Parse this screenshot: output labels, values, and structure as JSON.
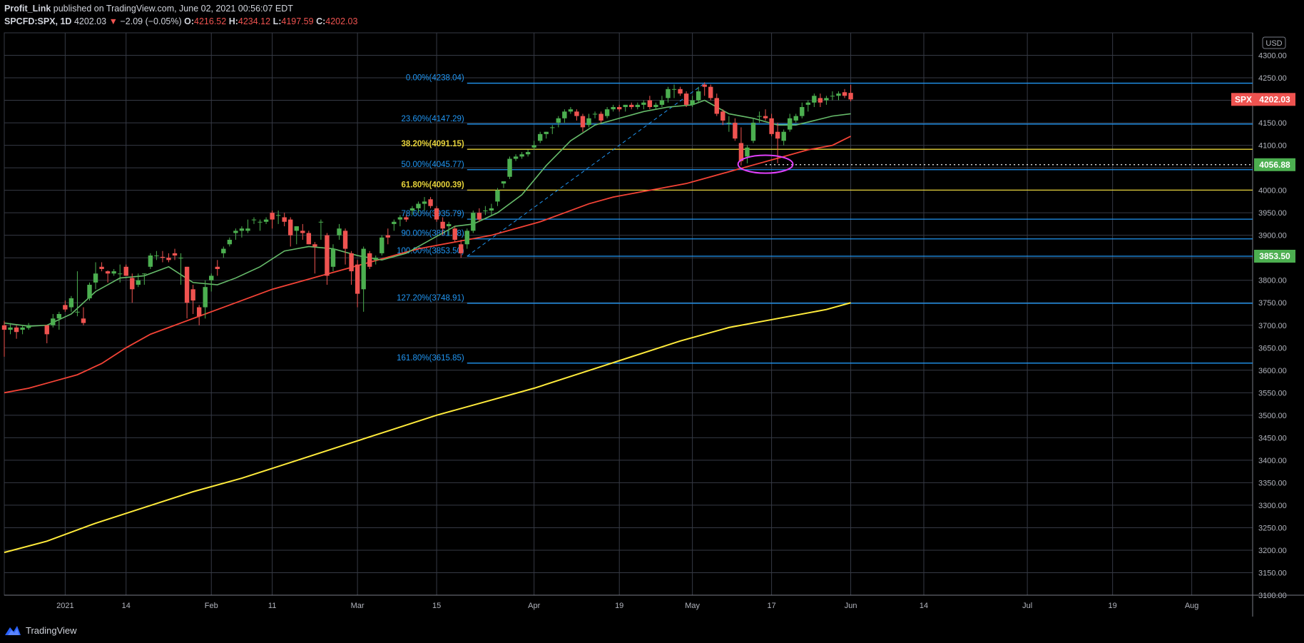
{
  "header": {
    "author": "Profit_Link",
    "published": "published on TradingView.com, June 02, 2021 00:56:07 EDT",
    "symbol": "SPCFD:SPX, 1D",
    "last": "4202.03",
    "change_arrow": "▼",
    "change": "−2.09 (−0.05%)",
    "o_label": "O:",
    "o_value": "4216.52",
    "h_label": "H:",
    "h_value": "4234.12",
    "l_label": "L:",
    "l_value": "4197.59",
    "c_label": "C:",
    "c_value": "4202.03"
  },
  "footer": {
    "brand": "TradingView"
  },
  "colors": {
    "background": "#000000",
    "grid": "#363a45",
    "up": "#4caf50",
    "down": "#ef5350",
    "ema_short": "#66bb6a",
    "ema_long": "#f44336",
    "ma_yellow": "#ffeb3b",
    "fib_blue": "#2196f3",
    "fib_yellow": "#e6d23a",
    "ellipse": "#e040fb"
  },
  "chart_data": {
    "type": "candlestick",
    "ylim": [
      3100,
      4350
    ],
    "currency": "USD",
    "y_ticks": [
      3100,
      3150,
      3200,
      3250,
      3300,
      3350,
      3400,
      3450,
      3500,
      3550,
      3600,
      3650,
      3700,
      3750,
      3800,
      3850,
      3900,
      3950,
      4000,
      4050,
      4100,
      4150,
      4200,
      4250,
      4300
    ],
    "x_ticks": [
      "2021",
      "14",
      "Feb",
      "11",
      "Mar",
      "15",
      "Apr",
      "19",
      "May",
      "17",
      "Jun",
      "14",
      "Jul",
      "19",
      "Aug"
    ],
    "x_tick_days": [
      3,
      13,
      27,
      37,
      51,
      64,
      80,
      94,
      106,
      119,
      132,
      144,
      161,
      175,
      188
    ],
    "x_range_days": [
      -7,
      198
    ],
    "candles": [
      [
        -7,
        3700,
        3710,
        3630,
        3690
      ],
      [
        -6,
        3690,
        3705,
        3680,
        3695
      ],
      [
        -5,
        3695,
        3700,
        3670,
        3685
      ],
      [
        -4,
        3690,
        3700,
        3680,
        3695
      ],
      [
        -3,
        3694,
        3705,
        3690,
        3700
      ],
      [
        0,
        3700,
        3700,
        3660,
        3680
      ],
      [
        1,
        3700,
        3725,
        3695,
        3715
      ],
      [
        2,
        3715,
        3730,
        3690,
        3725
      ],
      [
        3,
        3745,
        3755,
        3730,
        3735
      ],
      [
        4,
        3740,
        3765,
        3730,
        3760
      ],
      [
        5,
        3730,
        3820,
        3720,
        3730
      ],
      [
        6,
        3715,
        3740,
        3700,
        3705
      ],
      [
        7,
        3760,
        3795,
        3755,
        3790
      ],
      [
        8,
        3795,
        3840,
        3780,
        3815
      ],
      [
        9,
        3830,
        3840,
        3820,
        3825
      ],
      [
        10,
        3820,
        3822,
        3795,
        3815
      ],
      [
        11,
        3815,
        3825,
        3810,
        3820
      ],
      [
        12,
        3815,
        3835,
        3795,
        3815
      ],
      [
        13,
        3830,
        3835,
        3810,
        3810
      ],
      [
        14,
        3805,
        3815,
        3750,
        3780
      ],
      [
        15,
        3790,
        3815,
        3785,
        3800
      ],
      [
        16,
        3815,
        3815,
        3790,
        3815
      ],
      [
        17,
        3830,
        3860,
        3825,
        3855
      ],
      [
        18,
        3855,
        3865,
        3845,
        3855
      ],
      [
        19,
        3852,
        3865,
        3840,
        3850
      ],
      [
        20,
        3850,
        3860,
        3840,
        3845
      ],
      [
        21,
        3860,
        3870,
        3845,
        3855
      ],
      [
        22,
        3850,
        3860,
        3790,
        3850
      ],
      [
        23,
        3830,
        3830,
        3715,
        3750
      ],
      [
        24,
        3780,
        3790,
        3725,
        3755
      ],
      [
        25,
        3740,
        3745,
        3700,
        3720
      ],
      [
        26,
        3740,
        3800,
        3715,
        3785
      ],
      [
        27,
        3800,
        3815,
        3775,
        3810
      ],
      [
        28,
        3830,
        3845,
        3810,
        3825
      ],
      [
        29,
        3860,
        3875,
        3850,
        3870
      ],
      [
        30,
        3880,
        3895,
        3875,
        3890
      ],
      [
        31,
        3905,
        3915,
        3890,
        3910
      ],
      [
        32,
        3910,
        3920,
        3895,
        3915
      ],
      [
        33,
        3910,
        3935,
        3905,
        3915
      ],
      [
        34,
        3935,
        3940,
        3925,
        3935
      ],
      [
        35,
        3930,
        3935,
        3910,
        3930
      ],
      [
        36,
        3930,
        3940,
        3925,
        3935
      ],
      [
        37,
        3950,
        3955,
        3915,
        3935
      ],
      [
        38,
        3945,
        3955,
        3925,
        3945
      ],
      [
        39,
        3940,
        3950,
        3920,
        3930
      ],
      [
        40,
        3935,
        3940,
        3875,
        3900
      ],
      [
        41,
        3910,
        3920,
        3880,
        3920
      ],
      [
        42,
        3910,
        3925,
        3890,
        3905
      ],
      [
        43,
        3905,
        3910,
        3880,
        3880
      ],
      [
        44,
        3880,
        3885,
        3815,
        3875
      ],
      [
        45,
        3930,
        3935,
        3890,
        3930
      ],
      [
        46,
        3900,
        3905,
        3790,
        3810
      ],
      [
        47,
        3830,
        3880,
        3820,
        3870
      ],
      [
        48,
        3900,
        3925,
        3890,
        3915
      ],
      [
        49,
        3910,
        3915,
        3835,
        3870
      ],
      [
        50,
        3860,
        3865,
        3790,
        3820
      ],
      [
        51,
        3835,
        3845,
        3740,
        3770
      ],
      [
        52,
        3780,
        3875,
        3730,
        3870
      ],
      [
        53,
        3860,
        3865,
        3825,
        3830
      ],
      [
        54,
        3845,
        3855,
        3835,
        3850
      ],
      [
        55,
        3860,
        3900,
        3855,
        3895
      ],
      [
        56,
        3900,
        3915,
        3880,
        3895
      ],
      [
        57,
        3925,
        3935,
        3910,
        3930
      ],
      [
        58,
        3935,
        3945,
        3920,
        3940
      ],
      [
        59,
        3940,
        3945,
        3930,
        3935
      ],
      [
        60,
        3955,
        3965,
        3945,
        3960
      ],
      [
        61,
        3960,
        3975,
        3950,
        3970
      ],
      [
        62,
        3970,
        3985,
        3955,
        3975
      ],
      [
        63,
        3980,
        3985,
        3960,
        3965
      ],
      [
        64,
        3960,
        3965,
        3930,
        3935
      ],
      [
        65,
        3930,
        3940,
        3900,
        3915
      ],
      [
        66,
        3920,
        3930,
        3900,
        3925
      ],
      [
        67,
        3915,
        3920,
        3885,
        3890
      ],
      [
        68,
        3880,
        3890,
        3850,
        3860
      ],
      [
        69,
        3880,
        3915,
        3870,
        3910
      ],
      [
        70,
        3910,
        3955,
        3905,
        3950
      ],
      [
        71,
        3950,
        3960,
        3930,
        3935
      ],
      [
        72,
        3955,
        3965,
        3945,
        3955
      ],
      [
        73,
        3955,
        3970,
        3945,
        3960
      ],
      [
        74,
        3975,
        4005,
        3965,
        4000
      ],
      [
        75,
        4015,
        4020,
        4005,
        4020
      ],
      [
        76,
        4030,
        4075,
        4025,
        4070
      ],
      [
        77,
        4070,
        4080,
        4065,
        4075
      ],
      [
        78,
        4075,
        4085,
        4070,
        4080
      ],
      [
        79,
        4080,
        4090,
        4075,
        4085
      ],
      [
        80,
        4095,
        4110,
        4090,
        4100
      ],
      [
        81,
        4110,
        4130,
        4105,
        4125
      ],
      [
        82,
        4125,
        4130,
        4115,
        4130
      ],
      [
        83,
        4140,
        4145,
        4125,
        4140
      ],
      [
        84,
        4150,
        4165,
        4140,
        4160
      ],
      [
        85,
        4160,
        4180,
        4150,
        4175
      ],
      [
        86,
        4175,
        4185,
        4170,
        4180
      ],
      [
        87,
        4175,
        4180,
        4155,
        4165
      ],
      [
        88,
        4165,
        4170,
        4130,
        4140
      ],
      [
        89,
        4145,
        4170,
        4140,
        4160
      ],
      [
        90,
        4170,
        4175,
        4160,
        4170
      ],
      [
        91,
        4170,
        4175,
        4150,
        4155
      ],
      [
        92,
        4165,
        4185,
        4160,
        4180
      ],
      [
        93,
        4180,
        4190,
        4175,
        4185
      ],
      [
        94,
        4185,
        4190,
        4175,
        4180
      ],
      [
        95,
        4185,
        4190,
        4175,
        4190
      ],
      [
        96,
        4190,
        4195,
        4180,
        4185
      ],
      [
        97,
        4185,
        4195,
        4180,
        4190
      ],
      [
        98,
        4190,
        4200,
        4180,
        4195
      ],
      [
        99,
        4200,
        4210,
        4180,
        4185
      ],
      [
        100,
        4185,
        4195,
        4180,
        4190
      ],
      [
        101,
        4190,
        4210,
        4185,
        4200
      ],
      [
        102,
        4205,
        4230,
        4195,
        4225
      ],
      [
        103,
        4225,
        4235,
        4205,
        4225
      ],
      [
        104,
        4225,
        4230,
        4210,
        4215
      ],
      [
        105,
        4215,
        4220,
        4185,
        4190
      ],
      [
        106,
        4190,
        4210,
        4185,
        4200
      ],
      [
        107,
        4200,
        4230,
        4195,
        4220
      ],
      [
        108,
        4235,
        4240,
        4210,
        4230
      ],
      [
        109,
        4230,
        4235,
        4200,
        4205
      ],
      [
        110,
        4205,
        4215,
        4165,
        4170
      ],
      [
        111,
        4175,
        4180,
        4145,
        4155
      ],
      [
        112,
        4150,
        4165,
        4130,
        4150
      ],
      [
        113,
        4150,
        4160,
        4110,
        4115
      ],
      [
        114,
        4105,
        4140,
        4055,
        4065
      ],
      [
        115,
        4075,
        4100,
        4060,
        4095
      ],
      [
        116,
        4110,
        4160,
        4105,
        4150
      ],
      [
        117,
        4165,
        4175,
        4150,
        4165
      ],
      [
        118,
        4165,
        4180,
        4155,
        4160
      ],
      [
        119,
        4160,
        4170,
        4120,
        4125
      ],
      [
        120,
        4130,
        4150,
        4060,
        4115
      ],
      [
        121,
        4110,
        4135,
        4100,
        4130
      ],
      [
        122,
        4135,
        4170,
        4130,
        4160
      ],
      [
        123,
        4155,
        4170,
        4150,
        4165
      ],
      [
        124,
        4165,
        4195,
        4160,
        4185
      ],
      [
        125,
        4190,
        4200,
        4175,
        4195
      ],
      [
        126,
        4195,
        4215,
        4185,
        4210
      ],
      [
        127,
        4205,
        4215,
        4185,
        4195
      ],
      [
        128,
        4200,
        4210,
        4190,
        4205
      ],
      [
        129,
        4210,
        4220,
        4200,
        4210
      ],
      [
        130,
        4210,
        4220,
        4200,
        4215
      ],
      [
        131,
        4218,
        4225,
        4205,
        4210
      ],
      [
        132,
        4216.52,
        4234.12,
        4197.59,
        4202.03
      ]
    ],
    "ema_short": [
      [
        -7,
        3705
      ],
      [
        -3,
        3698
      ],
      [
        0,
        3700
      ],
      [
        4,
        3725
      ],
      [
        8,
        3775
      ],
      [
        12,
        3805
      ],
      [
        16,
        3810
      ],
      [
        20,
        3830
      ],
      [
        24,
        3795
      ],
      [
        28,
        3790
      ],
      [
        31,
        3805
      ],
      [
        35,
        3830
      ],
      [
        39,
        3865
      ],
      [
        43,
        3875
      ],
      [
        47,
        3870
      ],
      [
        51,
        3855
      ],
      [
        55,
        3845
      ],
      [
        59,
        3860
      ],
      [
        63,
        3890
      ],
      [
        67,
        3920
      ],
      [
        70,
        3925
      ],
      [
        74,
        3950
      ],
      [
        78,
        3990
      ],
      [
        82,
        4055
      ],
      [
        86,
        4110
      ],
      [
        90,
        4145
      ],
      [
        94,
        4160
      ],
      [
        98,
        4175
      ],
      [
        102,
        4185
      ],
      [
        106,
        4190
      ],
      [
        108,
        4200
      ],
      [
        112,
        4170
      ],
      [
        116,
        4160
      ],
      [
        120,
        4145
      ],
      [
        123,
        4145
      ],
      [
        126,
        4155
      ],
      [
        129,
        4165
      ],
      [
        132,
        4170
      ]
    ],
    "ema_long": [
      [
        -7,
        3550
      ],
      [
        -3,
        3560
      ],
      [
        1,
        3575
      ],
      [
        5,
        3590
      ],
      [
        9,
        3615
      ],
      [
        13,
        3650
      ],
      [
        17,
        3680
      ],
      [
        21,
        3700
      ],
      [
        25,
        3720
      ],
      [
        29,
        3740
      ],
      [
        33,
        3760
      ],
      [
        37,
        3780
      ],
      [
        41,
        3795
      ],
      [
        45,
        3810
      ],
      [
        49,
        3825
      ],
      [
        53,
        3840
      ],
      [
        57,
        3855
      ],
      [
        61,
        3870
      ],
      [
        65,
        3880
      ],
      [
        69,
        3890
      ],
      [
        73,
        3900
      ],
      [
        77,
        3915
      ],
      [
        81,
        3930
      ],
      [
        85,
        3950
      ],
      [
        89,
        3970
      ],
      [
        93,
        3985
      ],
      [
        97,
        3995
      ],
      [
        101,
        4005
      ],
      [
        105,
        4015
      ],
      [
        109,
        4030
      ],
      [
        113,
        4045
      ],
      [
        117,
        4060
      ],
      [
        121,
        4075
      ],
      [
        125,
        4090
      ],
      [
        129,
        4100
      ],
      [
        132,
        4120
      ]
    ],
    "ma_yellow": [
      [
        -7,
        3195
      ],
      [
        0,
        3220
      ],
      [
        8,
        3260
      ],
      [
        16,
        3295
      ],
      [
        24,
        3330
      ],
      [
        32,
        3360
      ],
      [
        40,
        3395
      ],
      [
        48,
        3430
      ],
      [
        56,
        3465
      ],
      [
        64,
        3500
      ],
      [
        72,
        3530
      ],
      [
        80,
        3560
      ],
      [
        88,
        3595
      ],
      [
        96,
        3630
      ],
      [
        104,
        3665
      ],
      [
        112,
        3695
      ],
      [
        120,
        3715
      ],
      [
        128,
        3735
      ],
      [
        132,
        3750
      ]
    ],
    "fib_levels": [
      {
        "label": "0.00%(4238.04)",
        "price": 4238.04,
        "color": "blue"
      },
      {
        "label": "23.60%(4147.29)",
        "price": 4147.29,
        "color": "blue"
      },
      {
        "label": "38.20%(4091.15)",
        "price": 4091.15,
        "color": "yellow"
      },
      {
        "label": "50.00%(4045.77)",
        "price": 4045.77,
        "color": "blue"
      },
      {
        "label": "61.80%(4000.39)",
        "price": 4000.39,
        "color": "yellow"
      },
      {
        "label": "78.60%(3935.79)",
        "price": 3935.79,
        "color": "blue"
      },
      {
        "label": "90.00%(3891.98)",
        "price": 3891.98,
        "color": "blue"
      },
      {
        "label": "100.00%(3853.50)",
        "price": 3853.5,
        "color": "blue"
      },
      {
        "label": "127.20%(3748.91)",
        "price": 3748.91,
        "color": "blue"
      },
      {
        "label": "161.80%(3615.85)",
        "price": 3615.85,
        "color": "blue"
      }
    ],
    "fib_start_day": 69,
    "fib_end_day": 132,
    "trend_line": {
      "from": [
        69,
        3853.5
      ],
      "to": [
        108,
        4238.04
      ]
    },
    "ellipse": {
      "center": [
        118,
        4058
      ],
      "rx_days": 4.5,
      "ry_price": 20
    },
    "dotted_level": {
      "price": 4056.88,
      "from_day": 118
    },
    "price_tags": [
      {
        "symbol": "SPX",
        "value": "4202.03",
        "price": 4202.03,
        "color": "#ef5350"
      },
      {
        "value": "4056.88",
        "price": 4056.88,
        "color": "#4caf50"
      },
      {
        "value": "3853.50",
        "price": 3853.5,
        "color": "#4caf50"
      }
    ]
  }
}
